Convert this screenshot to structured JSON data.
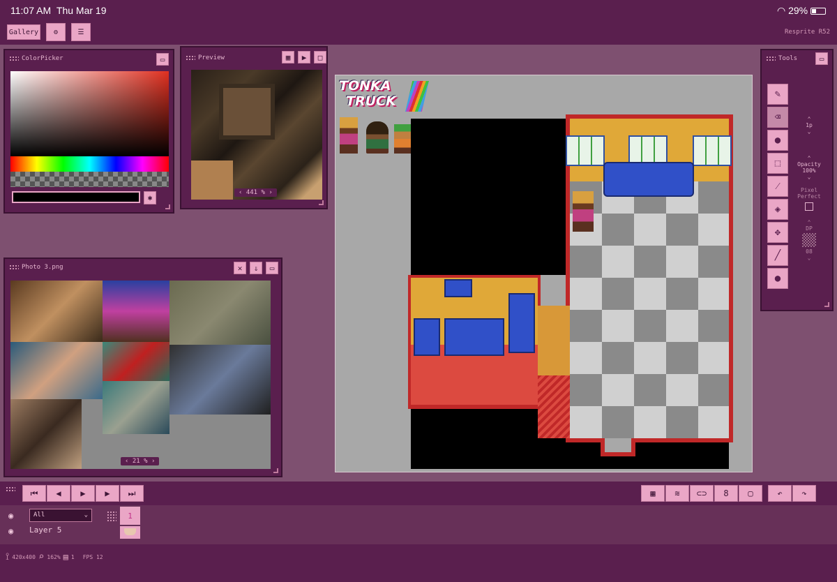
{
  "status": {
    "time": "11:07 AM",
    "date": "Thu Mar 19",
    "battery": "29%"
  },
  "topbar": {
    "gallery": "Gallery",
    "version": "Resprite R52"
  },
  "colorpicker": {
    "title": "ColorPicker"
  },
  "preview": {
    "title": "Preview",
    "zoom": "441 %"
  },
  "photo": {
    "title": "Photo 3.png",
    "zoom": "21 %"
  },
  "tools": {
    "title": "Tools",
    "brush_size": "1p",
    "opacity_label": "Opacity",
    "opacity_value": "100%",
    "pixel_perfect": "Pixel Perfect",
    "dp_label": "DP",
    "dp_value": "08"
  },
  "canvas": {
    "logo_line1": "TONKA",
    "logo_line2": "TRUCK"
  },
  "layers": {
    "filter": "All",
    "layer_name": "Layer 5",
    "frame_number": "1"
  },
  "footer": {
    "size": "420x400",
    "zoom": "162%",
    "frames": "1",
    "fps": "FPS 12"
  },
  "colors": {
    "bg": "#7e5070",
    "panel": "#5a1f4e",
    "button": "#eaa6c6"
  }
}
